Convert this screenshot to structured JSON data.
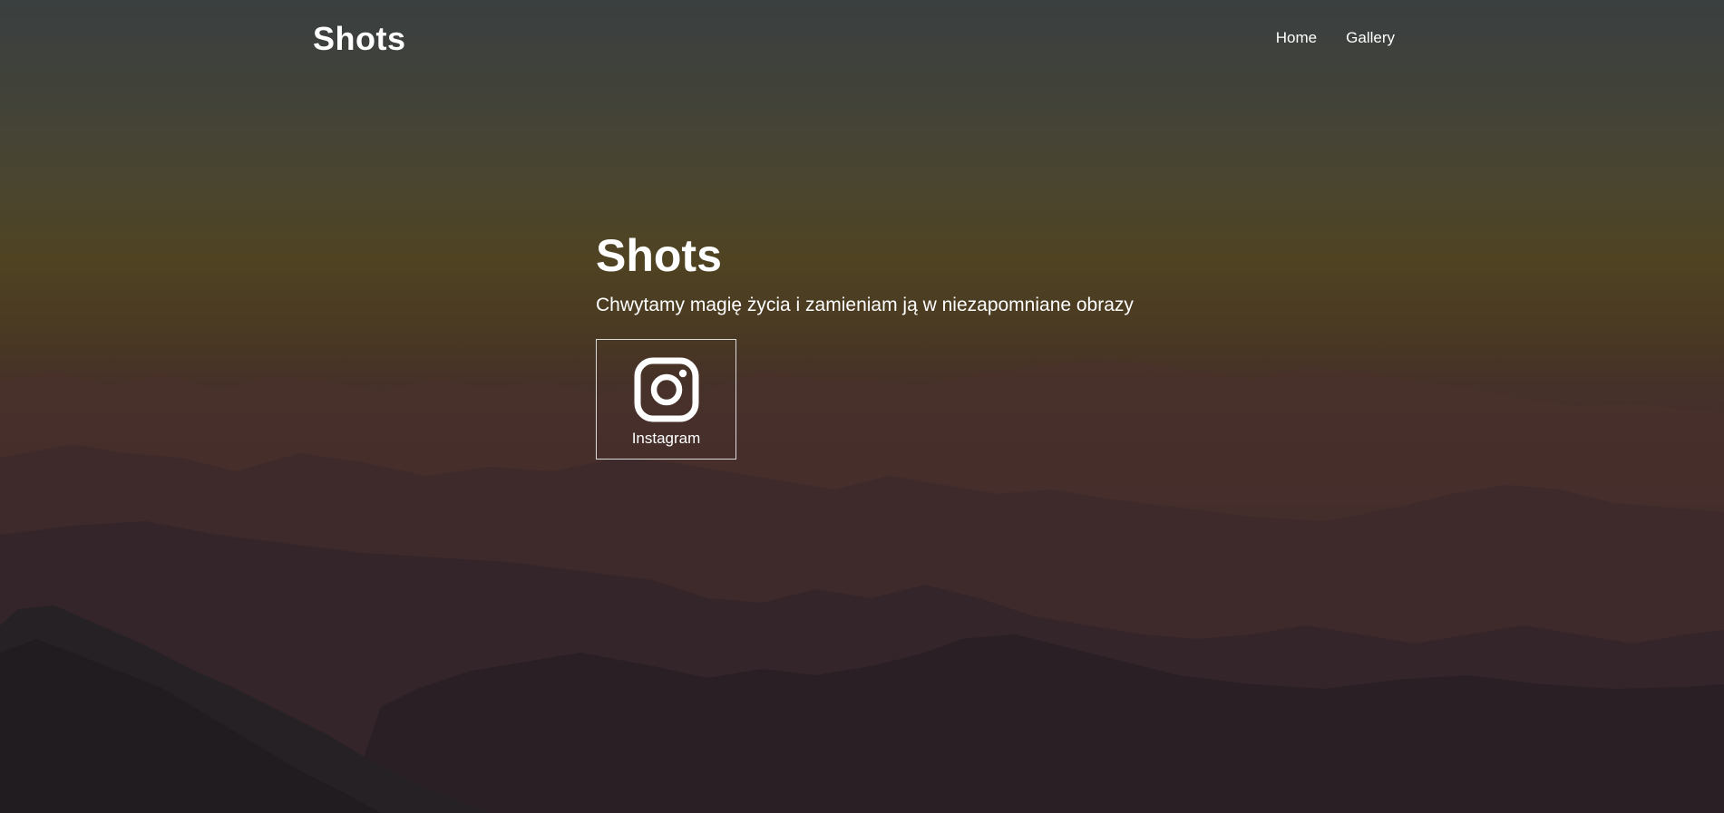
{
  "navbar": {
    "brand": "Shots",
    "links": [
      {
        "label": "Home"
      },
      {
        "label": "Gallery"
      }
    ]
  },
  "hero": {
    "title": "Shots",
    "subtitle": "Chwytamy magię życia i zamieniam ją w niezapomniane obrazy"
  },
  "social": {
    "instagram_label": "Instagram",
    "icon": "instagram-icon"
  },
  "colors": {
    "text": "#ffffff",
    "button_border": "#d9d9d9"
  }
}
